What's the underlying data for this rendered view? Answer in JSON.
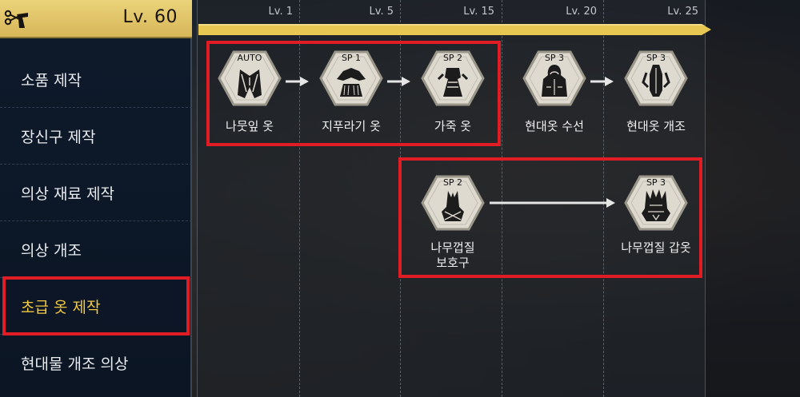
{
  "sidebar": {
    "level_label": "Lv. 60",
    "items": [
      {
        "label": "소품 제작"
      },
      {
        "label": "장신구 제작"
      },
      {
        "label": "의상 재료 제작"
      },
      {
        "label": "의상 개조"
      },
      {
        "label": "초급 옷 제작"
      },
      {
        "label": "현대물 개조 의상"
      }
    ],
    "active_index": 4
  },
  "timeline": {
    "columns": [
      "Lv. 1",
      "Lv. 5",
      "Lv. 15",
      "Lv. 20",
      "Lv. 25"
    ]
  },
  "nodes": [
    {
      "tag": "AUTO",
      "label": "나뭇잎 옷",
      "icon": "leaf-clothes-icon"
    },
    {
      "tag": "SP 1",
      "label": "지푸라기 옷",
      "icon": "straw-clothes-icon"
    },
    {
      "tag": "SP 2",
      "label": "가죽 옷",
      "icon": "leather-clothes-icon"
    },
    {
      "tag": "SP 3",
      "label": "현대옷 수선",
      "icon": "hooded-coat-icon"
    },
    {
      "tag": "SP 3",
      "label": "현대옷 개조",
      "icon": "modified-clothes-icon"
    },
    {
      "tag": "SP 2",
      "label_line1": "나무껍질",
      "label_line2": "보호구",
      "icon": "bark-guard-icon"
    },
    {
      "tag": "SP 3",
      "label": "나무껍질 갑옷",
      "icon": "bark-armor-icon"
    }
  ],
  "colors": {
    "accent_gold": "#f2c940",
    "highlight_red": "#e01c24",
    "banner_yellow": "#e8c752"
  }
}
